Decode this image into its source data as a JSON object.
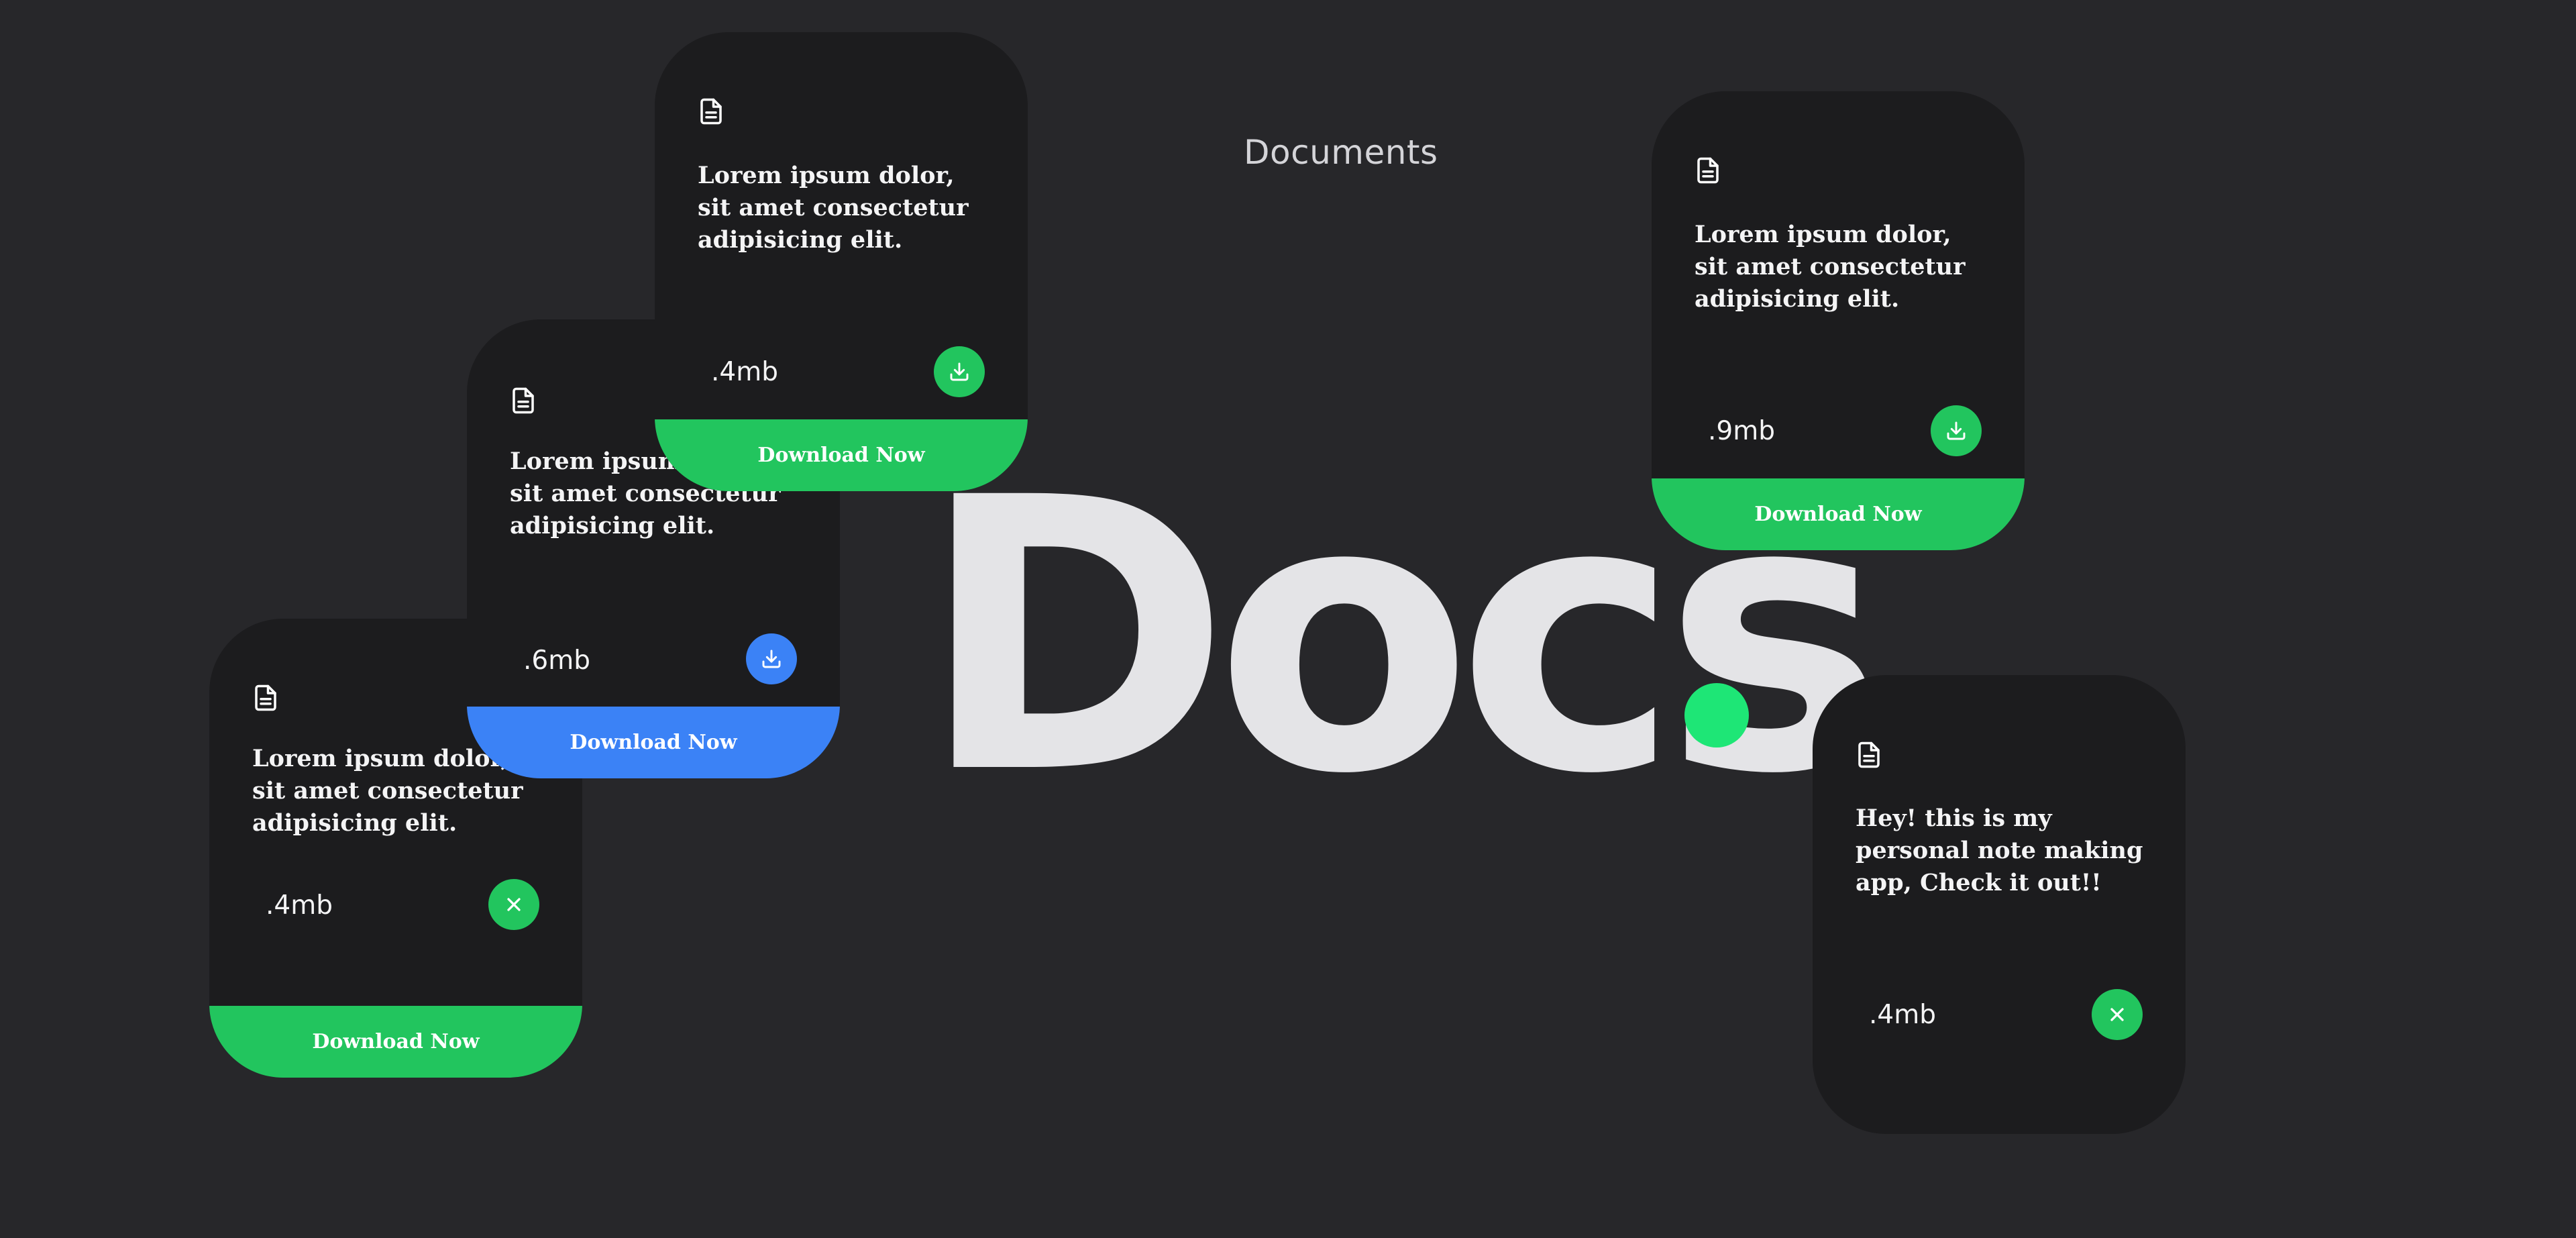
{
  "header": {
    "title": "Documents"
  },
  "hero": {
    "word": "Docs"
  },
  "colors": {
    "background": "#27272a",
    "card": "#1c1c1e",
    "green": "#22c55e",
    "blue": "#3b82f6",
    "dot": "#1ee676"
  },
  "cards": [
    {
      "text": "Lorem ipsum dolor, sit amet consectetur adipisicing elit.",
      "size": ".4mb",
      "action_icon": "close-icon",
      "download_label": "Download Now",
      "accent": "green"
    },
    {
      "text": "Lorem ipsum dolor, sit amet consectetur adipisicing elit.",
      "size": ".6mb",
      "action_icon": "download-icon",
      "download_label": "Download Now",
      "accent": "blue"
    },
    {
      "text": "Lorem ipsum dolor, sit amet consectetur adipisicing elit.",
      "size": ".4mb",
      "action_icon": "download-icon",
      "download_label": "Download Now",
      "accent": "green"
    },
    {
      "text": "Lorem ipsum dolor, sit amet consectetur adipisicing elit.",
      "size": ".9mb",
      "action_icon": "download-icon",
      "download_label": "Download Now",
      "accent": "green"
    },
    {
      "text": "Hey! this is my personal note making app, Check it out!!",
      "size": ".4mb",
      "action_icon": "close-icon",
      "accent": "green"
    }
  ]
}
